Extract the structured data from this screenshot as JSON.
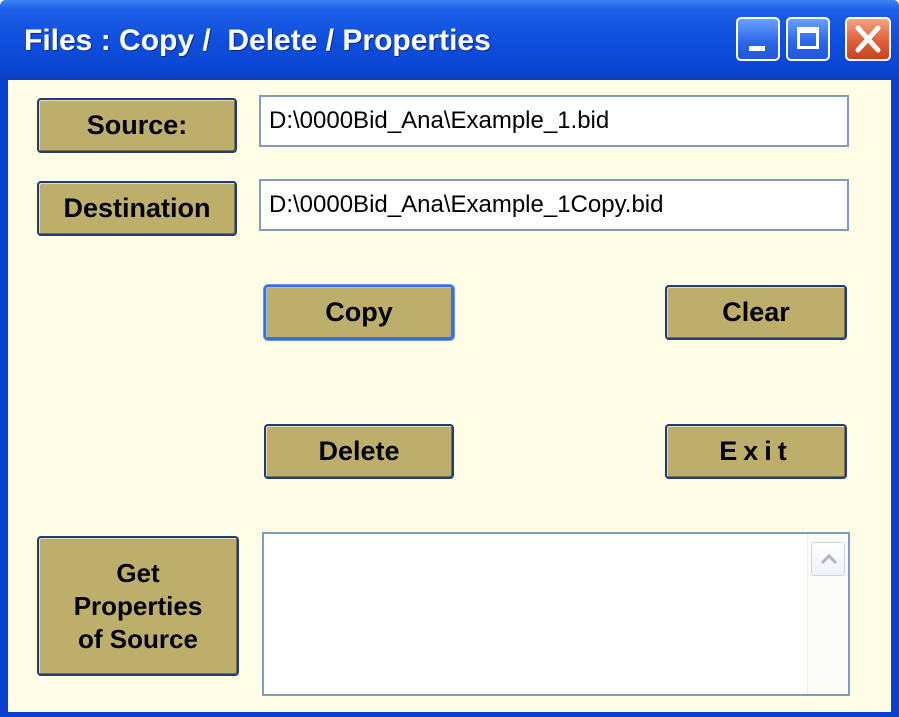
{
  "window": {
    "title": "Files : Copy /  Delete / Properties",
    "controls": {
      "minimize": "minimize-icon",
      "maximize": "maximize-icon",
      "close": "close-icon"
    }
  },
  "source": {
    "button_label": "Source:",
    "value": "D:\\0000Bid_Ana\\Example_1.bid"
  },
  "destination": {
    "button_label": "Destination",
    "value": "D:\\0000Bid_Ana\\Example_1Copy.bid"
  },
  "actions": {
    "copy_label": "Copy",
    "clear_label": "Clear",
    "delete_label": "Delete",
    "exit_label": "Exit"
  },
  "properties": {
    "button_line1": "Get",
    "button_line2": "Properties",
    "button_line3": "of Source",
    "output_text": ""
  },
  "colors": {
    "button_face": "#bdaf6b",
    "client_background": "#fffde6",
    "titlebar": "#0a46d2",
    "close_button": "#e0603a"
  }
}
